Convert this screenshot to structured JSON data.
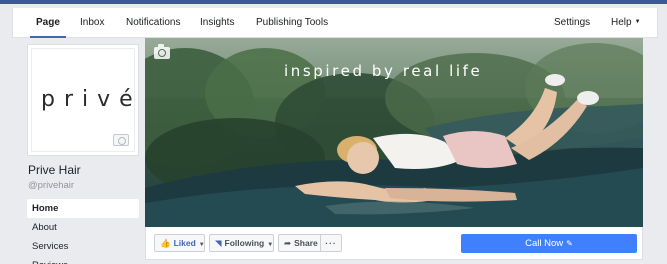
{
  "top_tabs": {
    "page": "Page",
    "inbox": "Inbox",
    "notifications": "Notifications",
    "insights": "Insights",
    "publishing_tools": "Publishing Tools",
    "settings": "Settings",
    "help": "Help",
    "active": "Page"
  },
  "profile": {
    "logo_text": "privé",
    "name": "Prive Hair",
    "handle": "@privehair"
  },
  "side_nav": {
    "items": [
      "Home",
      "About",
      "Services",
      "Reviews"
    ],
    "active": "Home"
  },
  "cover": {
    "tagline": "inspired by real life"
  },
  "actions": {
    "liked": "Liked",
    "following": "Following",
    "share": "Share",
    "more": "···",
    "call_now": "Call Now"
  },
  "icons": {
    "liked": "thumbs-up-icon",
    "following": "rss-feed-icon",
    "share": "share-arrow-icon",
    "call_now": "pencil-icon",
    "camera": "camera-icon"
  },
  "colors": {
    "brand_blue": "#4267b2",
    "cta_blue": "#4080ff",
    "page_bg": "#e9ebee"
  }
}
